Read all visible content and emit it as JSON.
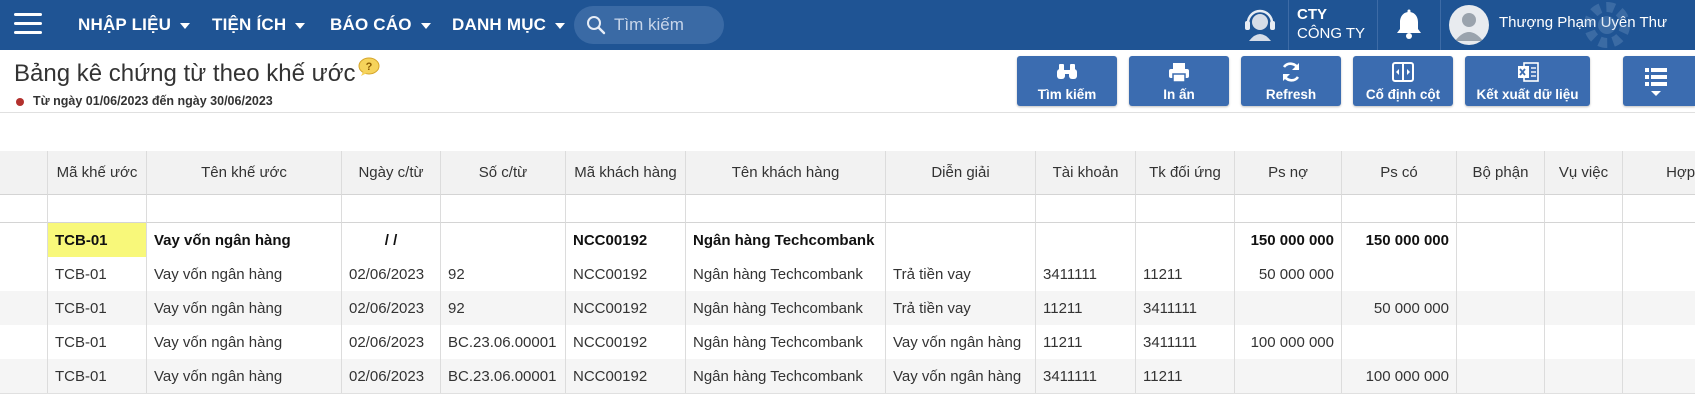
{
  "topbar": {
    "menus": [
      {
        "label": "NHẬP LIỆU"
      },
      {
        "label": "TIỆN ÍCH"
      },
      {
        "label": "BÁO CÁO"
      },
      {
        "label": "DANH MỤC"
      }
    ],
    "search_placeholder": "Tìm kiếm",
    "company_line1": "CTY",
    "company_line2": "CÔNG TY",
    "user_name": "Thượng Phạm Uyên Thư",
    "icons": [
      "menu-icon",
      "search-icon",
      "support-agent-icon",
      "bell-icon",
      "user-avatar-icon"
    ],
    "color": "#1f5494"
  },
  "page": {
    "title": "Bảng kê chứng từ theo khế ước",
    "date_range": "Từ ngày 01/06/2023 đến ngày 30/06/2023"
  },
  "toolbar": {
    "buttons": [
      {
        "label": "Tìm kiếm",
        "icon": "binoculars-icon"
      },
      {
        "label": "In ấn",
        "icon": "printer-icon"
      },
      {
        "label": "Refresh",
        "icon": "refresh-icon"
      },
      {
        "label": "Cố định cột",
        "icon": "freeze-column-icon"
      },
      {
        "label": "Kết xuất dữ liệu",
        "icon": "excel-icon"
      }
    ],
    "more_icon": "list-menu-icon",
    "button_color": "#3b6cb0"
  },
  "table": {
    "columns": [
      "Mã khế ước",
      "Tên khế ước",
      "Ngày c/từ",
      "Số c/từ",
      "Mã khách hàng",
      "Tên khách hàng",
      "Diễn giải",
      "Tài khoản",
      "Tk đối ứng",
      "Ps nợ",
      "Ps có",
      "Bộ phận",
      "Vụ việc",
      "Hợp đồ"
    ],
    "group_row": [
      "TCB-01",
      "Vay vốn ngân hàng",
      "/ /",
      "",
      "NCC00192",
      "Ngân hàng Techcombank",
      "",
      "",
      "",
      "150 000 000",
      "150 000 000",
      "",
      "",
      ""
    ],
    "rows": [
      [
        "TCB-01",
        "Vay vốn ngân hàng",
        "02/06/2023",
        "92",
        "NCC00192",
        "Ngân hàng Techcombank",
        "Trả tiền vay",
        "3411111",
        "11211",
        "50 000 000",
        "",
        "",
        "",
        ""
      ],
      [
        "TCB-01",
        "Vay vốn ngân hàng",
        "02/06/2023",
        "92",
        "NCC00192",
        "Ngân hàng Techcombank",
        "Trả tiền vay",
        "11211",
        "3411111",
        "",
        "50 000 000",
        "",
        "",
        ""
      ],
      [
        "TCB-01",
        "Vay vốn ngân hàng",
        "02/06/2023",
        "BC.23.06.00001",
        "NCC00192",
        "Ngân hàng Techcombank",
        "Vay vốn ngân hàng",
        "11211",
        "3411111",
        "100 000 000",
        "",
        "",
        "",
        ""
      ],
      [
        "TCB-01",
        "Vay vốn ngân hàng",
        "02/06/2023",
        "BC.23.06.00001",
        "NCC00192",
        "Ngân hàng Techcombank",
        "Vay vốn ngân hàng",
        "3411111",
        "11211",
        "",
        "100 000 000",
        "",
        "",
        ""
      ]
    ],
    "highlight_color": "#f8f87a",
    "stripe_color": "#f5f5f5"
  }
}
